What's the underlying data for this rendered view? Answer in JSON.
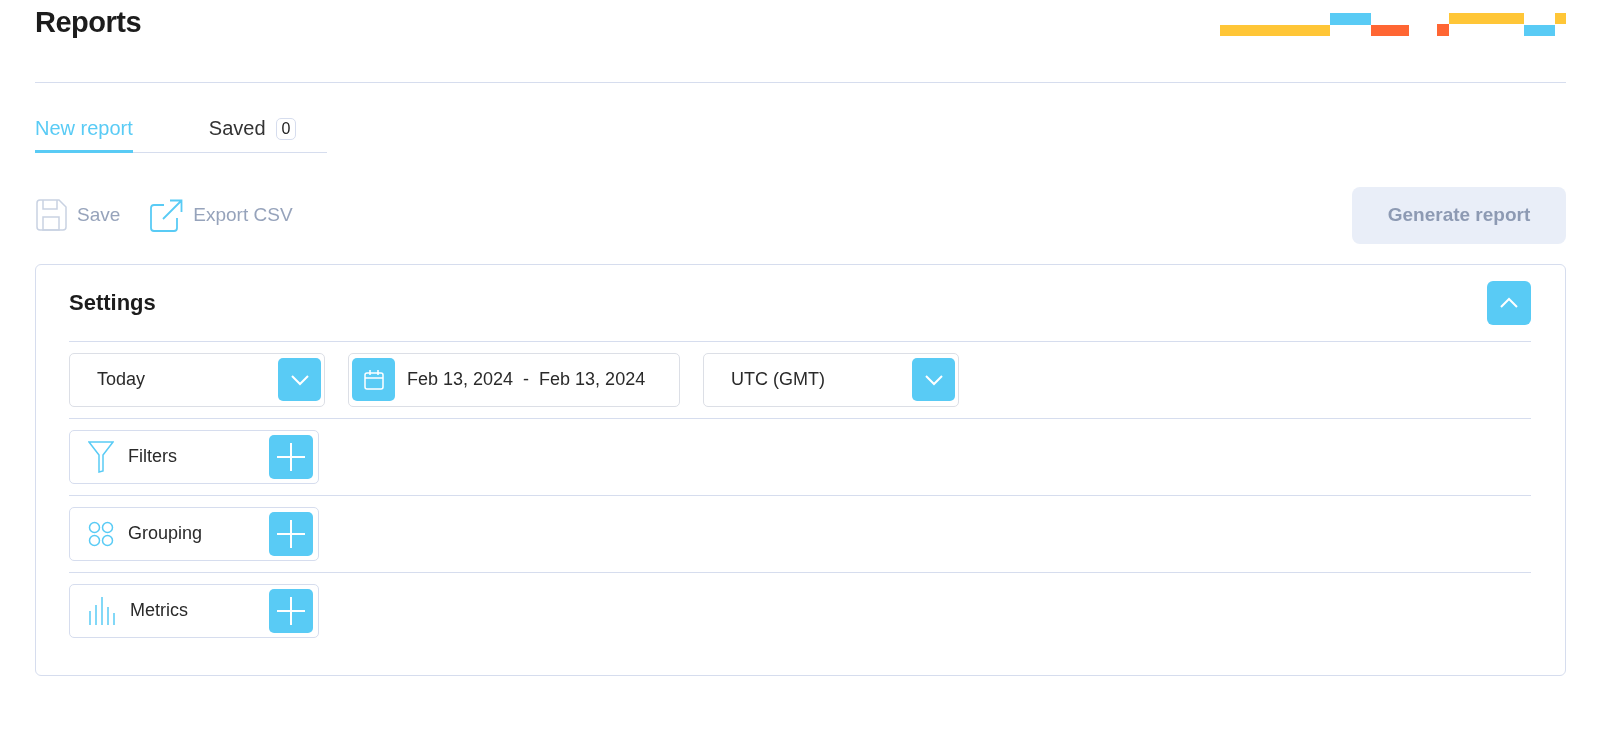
{
  "page": {
    "title": "Reports"
  },
  "tabs": [
    {
      "label": "New report",
      "selected": true
    },
    {
      "label": "Saved",
      "selected": false,
      "badge": "0"
    }
  ],
  "actions": [
    {
      "kind": "save",
      "label": "Save",
      "disabled": true
    },
    {
      "kind": "export",
      "label": "Export CSV",
      "disabled": true
    }
  ],
  "generate_button": {
    "label": "Generate report",
    "disabled": true
  },
  "settings": {
    "title": "Settings",
    "expanded": true,
    "selectors": [
      {
        "kind": "dropdown",
        "value": "Today"
      },
      {
        "kind": "daterange",
        "value": "Feb 13, 2024  -  Feb 13, 2024"
      },
      {
        "kind": "dropdown",
        "value": "UTC (GMT)"
      }
    ],
    "sections": [
      {
        "kind": "filters",
        "label": "Filters"
      },
      {
        "kind": "grouping",
        "label": "Grouping"
      },
      {
        "kind": "metrics",
        "label": "Metrics"
      }
    ]
  }
}
